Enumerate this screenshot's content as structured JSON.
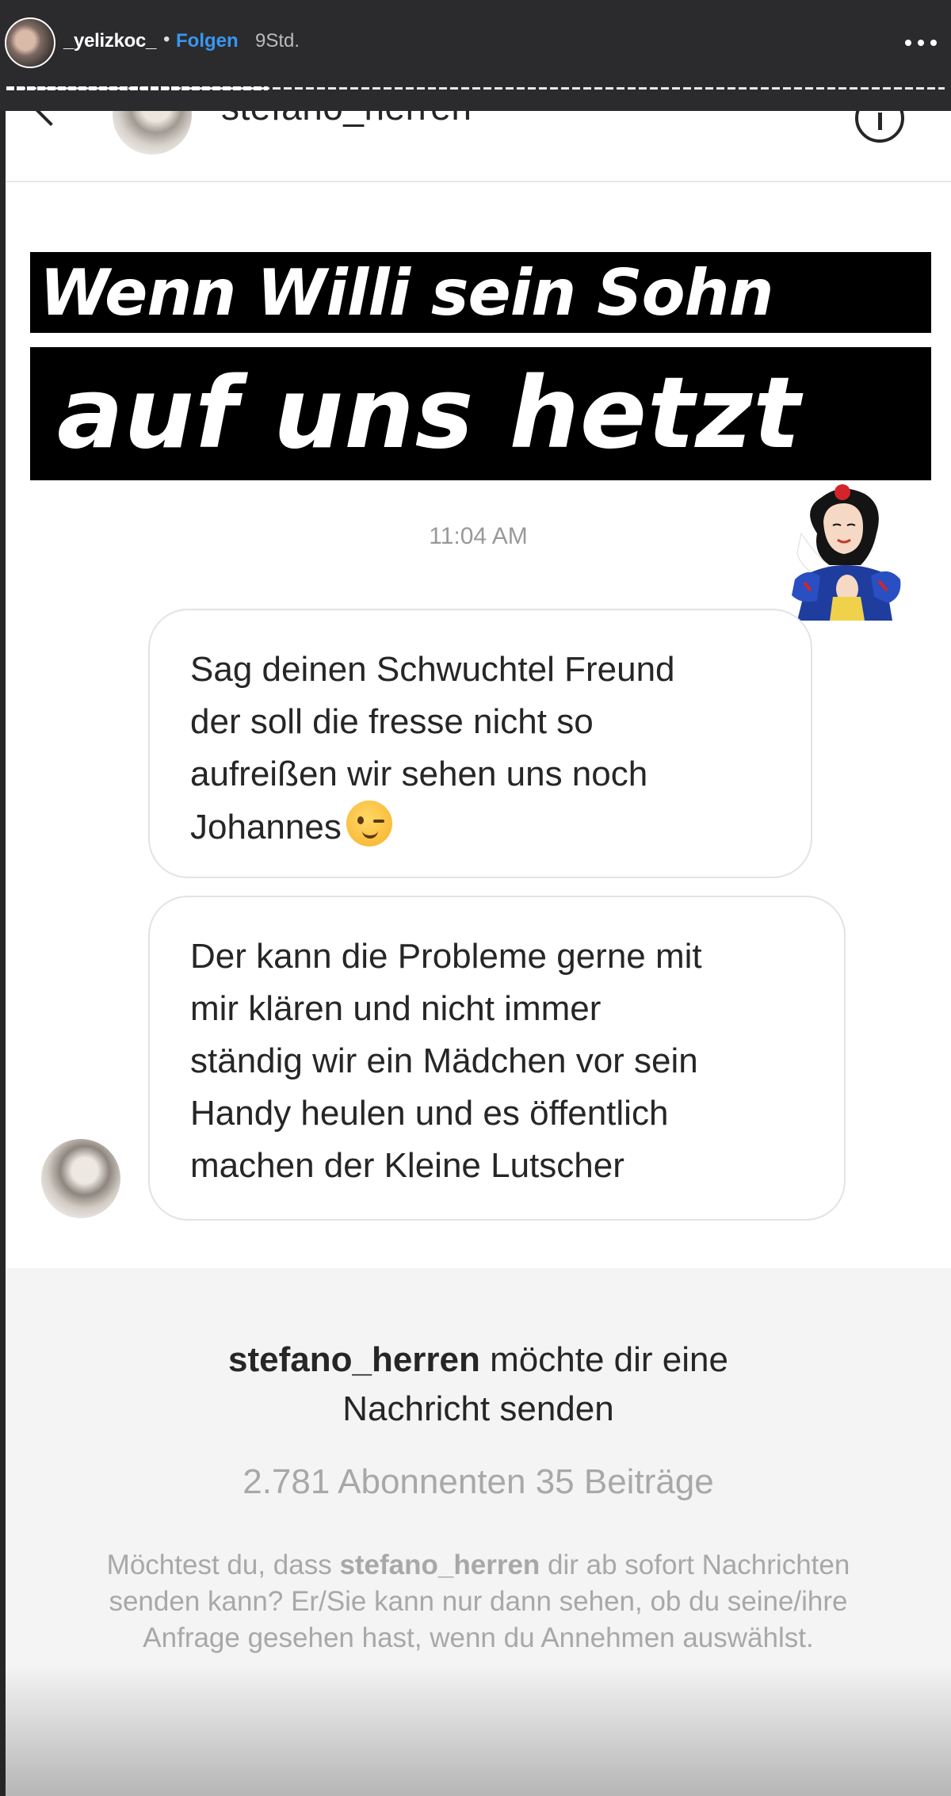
{
  "story": {
    "username": "_yelizkoc_",
    "separator": "•",
    "follow_label": "Folgen",
    "time_ago": "9Std."
  },
  "dm": {
    "header_name": "stefano_herren",
    "sticker_line1": "Wenn Willi sein Sohn",
    "sticker_line2": "auf uns hetzt",
    "timestamp": "11:04 AM",
    "messages": [
      {
        "text": "Sag deinen Schwuchtel Freund\nder soll die fresse nicht so\naufreißen wir sehen uns noch\nJohannes",
        "emoji": "winking-face"
      },
      {
        "text": "Der kann die Probleme gerne mit\nmir klären und nicht immer\nständig wir ein Mädchen vor sein\nHandy heulen und es öffentlich\nmachen der Kleine Lutscher"
      }
    ]
  },
  "request": {
    "username": "stefano_herren",
    "title_rest": " möchte dir eine",
    "title_line2": "Nachricht senden",
    "stats": "2.781 Abonnenten 35 Beiträge",
    "desc_before": "Möchtest du, dass ",
    "desc_username": "stefano_herren",
    "desc_after": " dir ab sofort Nachrichten senden kann? Er/Sie kann nur dann sehen, ob du seine/ihre Anfrage gesehen hast, wenn du Annehmen auswählst."
  },
  "colors": {
    "accent": "#3897f0",
    "story_bar": "#2b2b2d",
    "secondary_text": "#a8a8a8"
  }
}
